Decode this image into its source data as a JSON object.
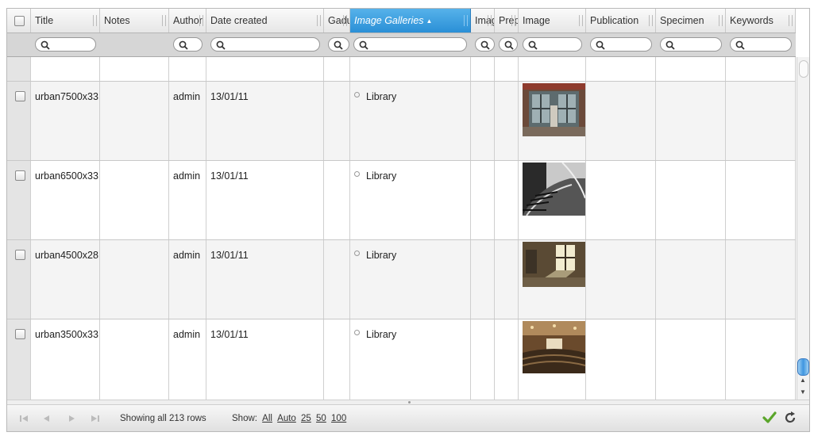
{
  "columns": [
    {
      "label": "Title"
    },
    {
      "label": "Notes"
    },
    {
      "label": "Author"
    },
    {
      "label": "Date created"
    },
    {
      "label": "Gadu"
    },
    {
      "label": "Image Galleries"
    },
    {
      "label": "Imag"
    },
    {
      "label": "Prep"
    },
    {
      "label": "Image"
    },
    {
      "label": "Publication"
    },
    {
      "label": "Specimen"
    },
    {
      "label": "Keywords"
    }
  ],
  "sort": {
    "column": "Image Galleries",
    "direction": "ascending"
  },
  "rows": [
    {
      "title": "urban7500x33",
      "author": "admin",
      "date": "13/01/11",
      "gallery": "Library",
      "image": "doorway-photo"
    },
    {
      "title": "urban6500x33",
      "author": "admin",
      "date": "13/01/11",
      "gallery": "Library",
      "image": "staircase-photo"
    },
    {
      "title": "urban4500x28",
      "author": "admin",
      "date": "13/01/11",
      "gallery": "Library",
      "image": "window-room-photo"
    },
    {
      "title": "urban3500x33",
      "author": "admin",
      "date": "13/01/11",
      "gallery": "Library",
      "image": "theater-photo"
    }
  ],
  "footer": {
    "showing": "Showing all 213 rows",
    "show_label": "Show:",
    "show_options": [
      "All",
      "Auto",
      "25",
      "50",
      "100"
    ]
  },
  "colors": {
    "accent": "#3a9de0",
    "confirm": "#5aa52a"
  },
  "icons": [
    "search-icon",
    "first-page-icon",
    "prev-page-icon",
    "next-page-icon",
    "last-page-icon",
    "confirm-check-icon",
    "refresh-icon"
  ]
}
